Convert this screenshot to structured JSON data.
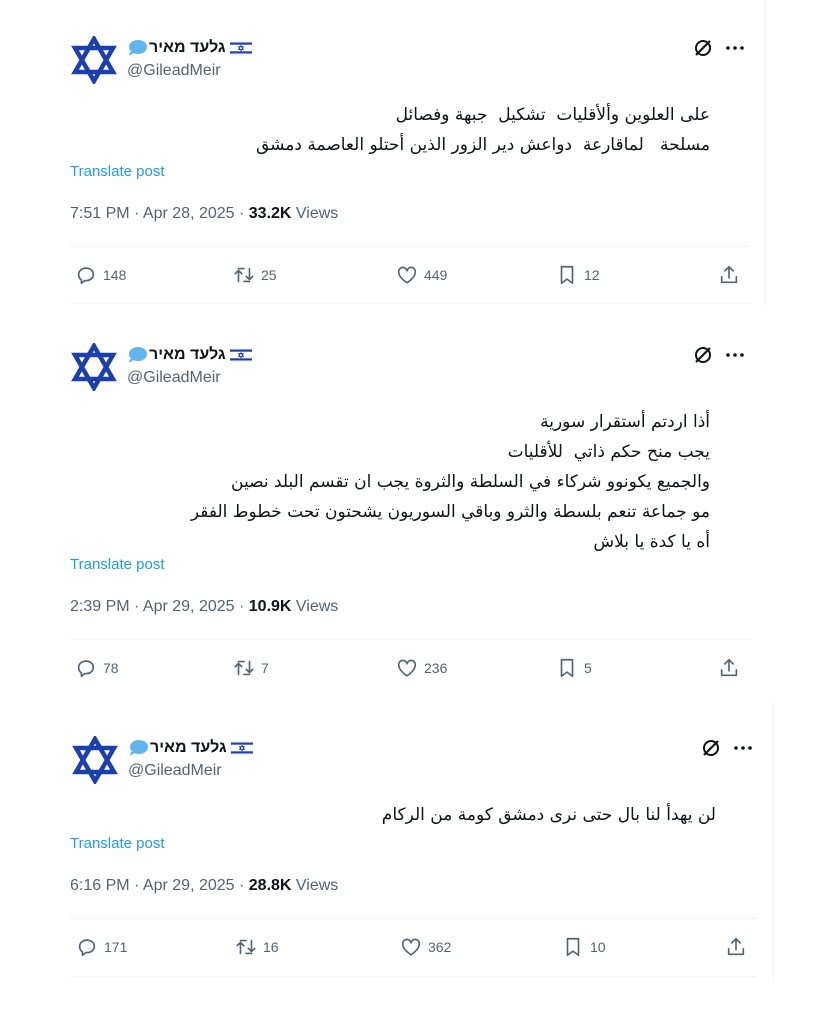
{
  "posts": [
    {
      "display_name": "גלעד מאיר",
      "handle": "@GileadMeir",
      "text": "على العلوين وألأقليات  تشكيل  جبهة وفصائل\nمسلحة   لماقارعة  دواعش دير الزور الذين أحتلو العاصمة دمشق",
      "translate_label": "Translate post",
      "time": "7:51 PM · Apr 28, 2025 · ",
      "views_count": "33.2K",
      "views_label": " Views",
      "replies": "148",
      "reposts": "25",
      "likes": "449",
      "bookmarks": "12"
    },
    {
      "display_name": "גלעד מאיר",
      "handle": "@GileadMeir",
      "text": "أذا اردتم أستقرار سورية\nيجب منح حكم ذاتي  للأقليات\nوالجميع يكونوو شركاء في السلطة والثروة يجب ان تقسم البلد نصين\nمو جماعة تنعم بلسطة والثرو وباقي السوريون يشحتون تحت خطوط الفقر\nأه يا كدة يا بلاش",
      "translate_label": "Translate post",
      "time": "2:39 PM · Apr 29, 2025 · ",
      "views_count": "10.9K",
      "views_label": " Views",
      "replies": "78",
      "reposts": "7",
      "likes": "236",
      "bookmarks": "5"
    },
    {
      "display_name": "גלעד מאיר",
      "handle": "@GileadMeir",
      "text": "لن يهدأ لنا بال حتى نرى دمشق كومة من الركام",
      "translate_label": "Translate post",
      "time": "6:16 PM · Apr 29, 2025 · ",
      "views_count": "28.8K",
      "views_label": " Views",
      "replies": "171",
      "reposts": "16",
      "likes": "362",
      "bookmarks": "10"
    }
  ],
  "icons": {
    "avatar": "star-of-david-icon",
    "name_emoji": "speech-bubble-icon",
    "name_flag": "israel-flag-icon",
    "grok": "grok-icon",
    "more": "more-icon",
    "reply": "reply-icon",
    "repost": "repost-icon",
    "like": "like-icon",
    "bookmark": "bookmark-icon",
    "share": "share-icon"
  },
  "colors": {
    "avatar_blue": "#1c3fae",
    "link_blue": "#1d9bf0",
    "secondary_text": "#536471",
    "primary_text": "#0f1419"
  }
}
